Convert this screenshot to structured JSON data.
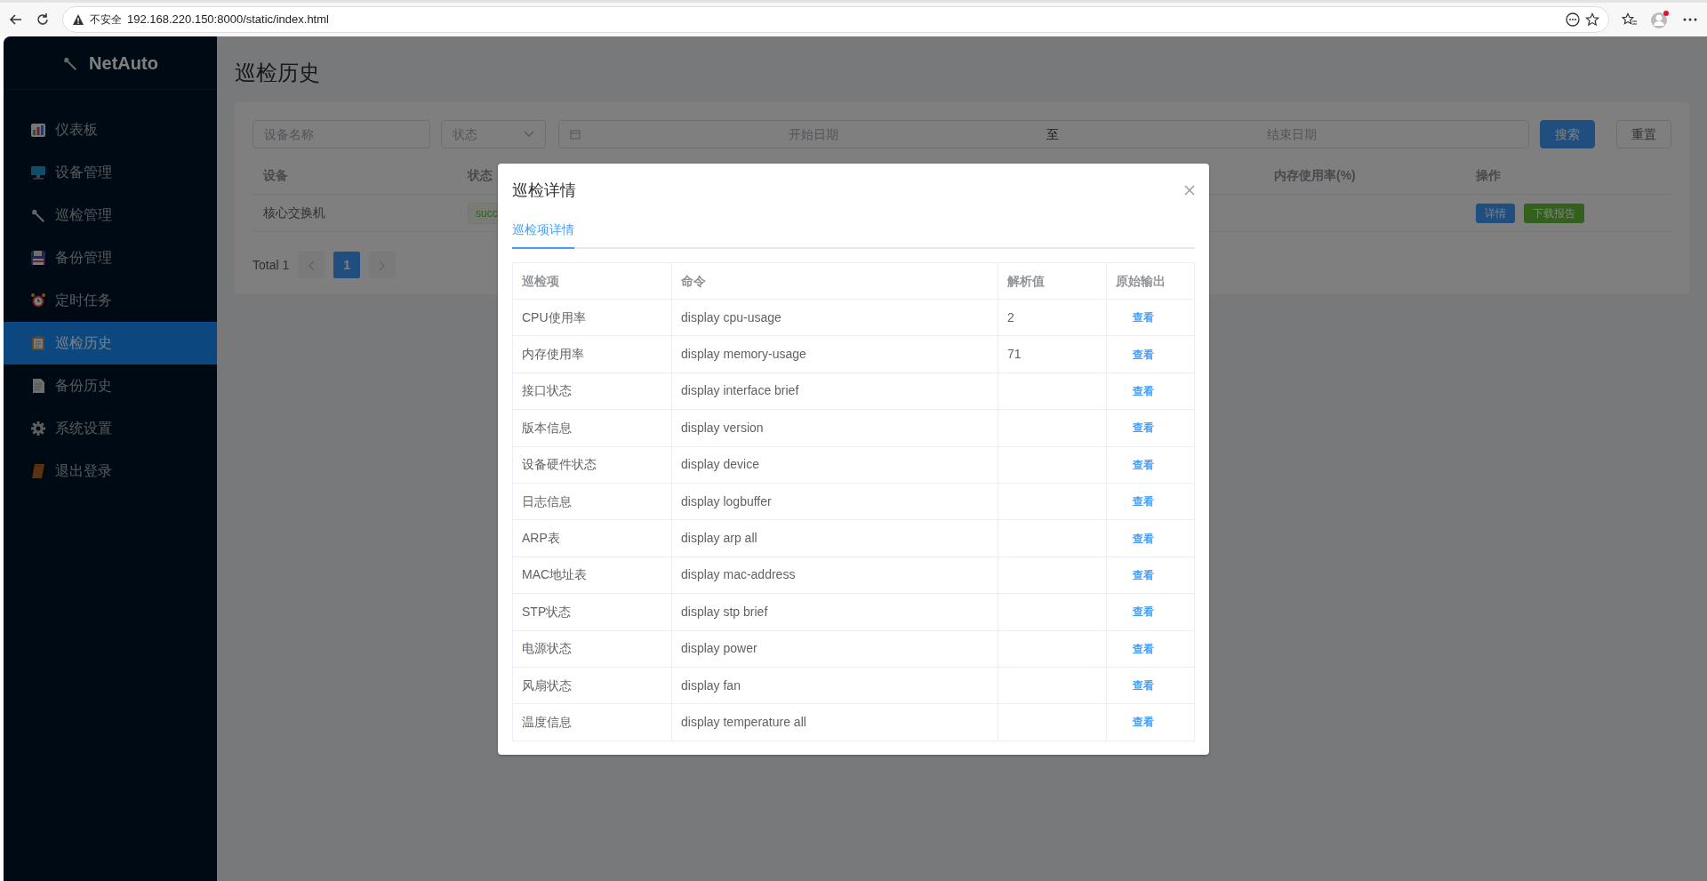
{
  "browser": {
    "security_label": "不安全",
    "url": "192.168.220.150:8000/static/index.html"
  },
  "sidebar": {
    "brand": "NetAuto",
    "items": [
      {
        "label": "仪表板",
        "selected": false
      },
      {
        "label": "设备管理",
        "selected": false
      },
      {
        "label": "巡检管理",
        "selected": false
      },
      {
        "label": "备份管理",
        "selected": false
      },
      {
        "label": "定时任务",
        "selected": false
      },
      {
        "label": "巡检历史",
        "selected": true
      },
      {
        "label": "备份历史",
        "selected": false
      },
      {
        "label": "系统设置",
        "selected": false
      },
      {
        "label": "退出登录",
        "selected": false
      }
    ]
  },
  "page": {
    "title": "巡检历史"
  },
  "filters": {
    "device_placeholder": "设备名称",
    "status_placeholder": "状态",
    "start_placeholder": "开始日期",
    "separator": "至",
    "end_placeholder": "结束日期",
    "buttons": [
      {
        "label": "搜索",
        "kind": "primary"
      },
      {
        "label": "重置",
        "kind": "default"
      }
    ]
  },
  "history_table": {
    "columns": [
      "设备",
      "状态",
      "内存使用率(%)",
      "操作"
    ],
    "rows": [
      {
        "device": "核心交换机",
        "status": "succ",
        "actions": [
          {
            "label": "详情",
            "kind": "primary"
          },
          {
            "label": "下载报告",
            "kind": "success"
          }
        ]
      }
    ]
  },
  "pagination": {
    "total": "Total 1",
    "pages": [
      {
        "label": "1",
        "selected": true
      }
    ]
  },
  "modal": {
    "title": "巡检详情",
    "tabs": [
      {
        "label": "巡检项详情",
        "selected": true
      }
    ],
    "table": {
      "columns": [
        "巡检项",
        "命令",
        "解析值",
        "原始输出"
      ],
      "rows": [
        {
          "item": "CPU使用率",
          "command": "display cpu-usage",
          "value": "2",
          "action": "查看"
        },
        {
          "item": "内存使用率",
          "command": "display memory-usage",
          "value": "71",
          "action": "查看"
        },
        {
          "item": "接口状态",
          "command": "display interface brief",
          "action": "查看"
        },
        {
          "item": "版本信息",
          "command": "display version",
          "action": "查看"
        },
        {
          "item": "设备硬件状态",
          "command": "display device",
          "action": "查看"
        },
        {
          "item": "日志信息",
          "command": "display logbuffer",
          "action": "查看"
        },
        {
          "item": "ARP表",
          "command": "display arp all",
          "action": "查看"
        },
        {
          "item": "MAC地址表",
          "command": "display mac-address",
          "action": "查看"
        },
        {
          "item": "STP状态",
          "command": "display stp brief",
          "action": "查看"
        },
        {
          "item": "电源状态",
          "command": "display power",
          "action": "查看"
        },
        {
          "item": "风扇状态",
          "command": "display fan",
          "action": "查看"
        },
        {
          "item": "温度信息",
          "command": "display temperature all",
          "action": "查看"
        }
      ]
    }
  }
}
